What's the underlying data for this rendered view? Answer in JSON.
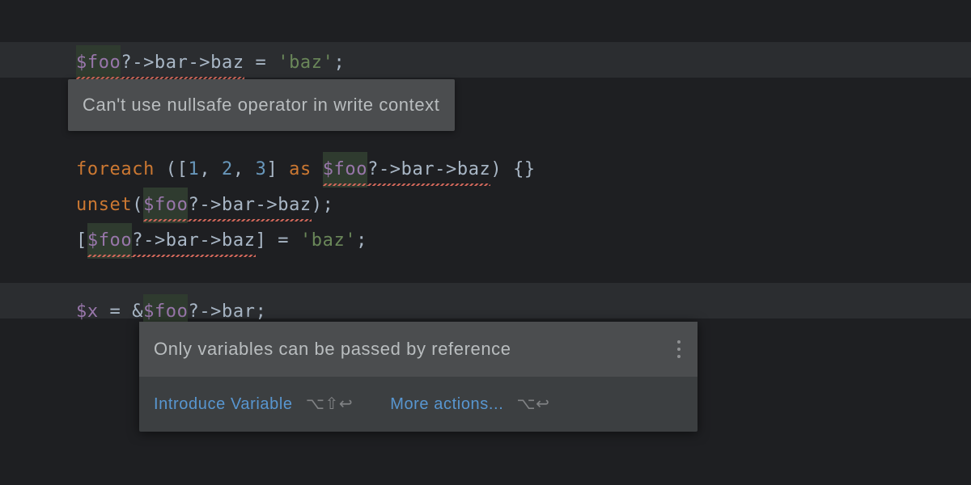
{
  "code": {
    "lines": [
      {
        "tokens": [
          {
            "t": "$foo",
            "cls": "c-var hl-span bg-dark-olive squiggle"
          },
          {
            "t": "?->bar->baz",
            "cls": "c-op squiggle"
          },
          {
            "t": " = ",
            "cls": "c-op"
          },
          {
            "t": "'baz'",
            "cls": "c-str"
          },
          {
            "t": ";",
            "cls": "c-punc"
          }
        ]
      },
      {
        "tokens": []
      },
      {
        "tokens": []
      },
      {
        "tokens": [
          {
            "t": "foreach ",
            "cls": "c-kw"
          },
          {
            "t": "([",
            "cls": "c-punc"
          },
          {
            "t": "1",
            "cls": "c-num"
          },
          {
            "t": ", ",
            "cls": "c-punc"
          },
          {
            "t": "2",
            "cls": "c-num"
          },
          {
            "t": ", ",
            "cls": "c-punc"
          },
          {
            "t": "3",
            "cls": "c-num"
          },
          {
            "t": "] ",
            "cls": "c-punc"
          },
          {
            "t": "as ",
            "cls": "c-kw"
          },
          {
            "t": "$foo",
            "cls": "c-var hl-span bg-dark-olive squiggle"
          },
          {
            "t": "?->bar->baz",
            "cls": "c-op squiggle"
          },
          {
            "t": ") {}",
            "cls": "c-punc"
          }
        ]
      },
      {
        "tokens": [
          {
            "t": "unset",
            "cls": "c-kw"
          },
          {
            "t": "(",
            "cls": "c-punc"
          },
          {
            "t": "$foo",
            "cls": "c-var hl-span bg-dark-olive squiggle"
          },
          {
            "t": "?->bar->baz",
            "cls": "c-op squiggle"
          },
          {
            "t": ");",
            "cls": "c-punc"
          }
        ]
      },
      {
        "tokens": [
          {
            "t": "[",
            "cls": "c-punc"
          },
          {
            "t": "$foo",
            "cls": "c-var hl-span bg-dark-olive squiggle"
          },
          {
            "t": "?->bar->baz",
            "cls": "c-op squiggle"
          },
          {
            "t": "] = ",
            "cls": "c-op"
          },
          {
            "t": "'baz'",
            "cls": "c-str"
          },
          {
            "t": ";",
            "cls": "c-punc"
          }
        ]
      },
      {
        "tokens": []
      },
      {
        "tokens": [
          {
            "t": "$x",
            "cls": "c-var"
          },
          {
            "t": " = &",
            "cls": "c-op"
          },
          {
            "t": "$foo",
            "cls": "c-var hl-span bg-dark-olive squiggle"
          },
          {
            "t": "?->bar",
            "cls": "c-op squiggle"
          },
          {
            "t": ";",
            "cls": "c-punc"
          }
        ]
      }
    ]
  },
  "tooltip": {
    "message": "Can't use nullsafe operator in write context"
  },
  "intention": {
    "message": "Only variables can be passed by reference",
    "action1_label": "Introduce Variable",
    "action1_shortcut": "⌥⇧↩",
    "action2_label": "More actions...",
    "action2_shortcut": "⌥↩"
  }
}
